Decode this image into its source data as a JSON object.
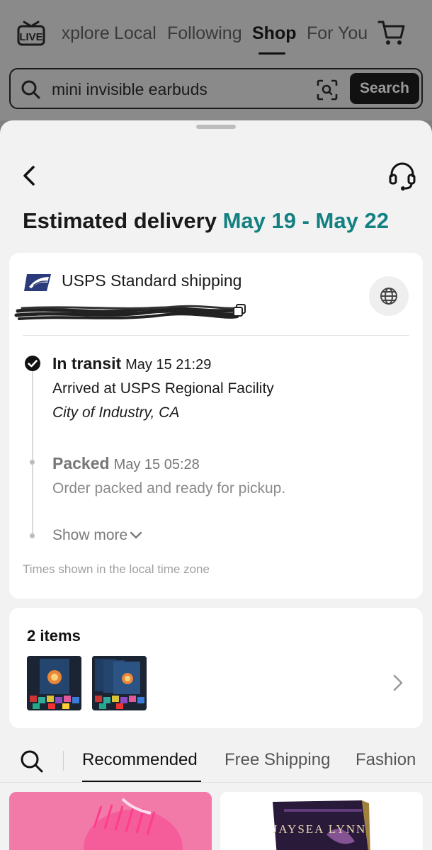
{
  "top_nav": {
    "live_label": "LIVE",
    "tabs": [
      "Explore",
      "Local",
      "Following",
      "Shop",
      "For You"
    ],
    "active_tab": "Shop"
  },
  "search": {
    "query": "mini invisible earbuds",
    "button_label": "Search"
  },
  "delivery": {
    "label": "Estimated delivery",
    "dates": "May 19 - May 22"
  },
  "shipping": {
    "carrier": "USPS Standard shipping"
  },
  "timeline": [
    {
      "status": "In transit",
      "time": "May 15 21:29",
      "description": "Arrived at USPS Regional Facility",
      "location": "City of Industry, CA"
    },
    {
      "status": "Packed",
      "time": "May 15 05:28",
      "description": "Order packed and ready for pickup."
    }
  ],
  "show_more_label": "Show more",
  "timezone_note": "Times shown in the local time zone",
  "items": {
    "count_label": "2 items"
  },
  "bottom_tabs": {
    "tabs": [
      "Recommended",
      "Free Shipping",
      "Fashion"
    ],
    "active": "Recommended"
  },
  "recommendations": {
    "book_author_text": "JAYSEA LYNN"
  },
  "colors": {
    "accent_teal": "#138081",
    "background_dim": "#8a8a8a",
    "sheet_bg": "#f2f2f2"
  },
  "icons": [
    "live-icon",
    "cart-icon",
    "search-icon",
    "scan-icon",
    "back-icon",
    "headset-icon",
    "usps-logo",
    "copy-icon",
    "globe-icon",
    "check-circle-icon",
    "chevron-down-icon",
    "chevron-right-icon"
  ]
}
